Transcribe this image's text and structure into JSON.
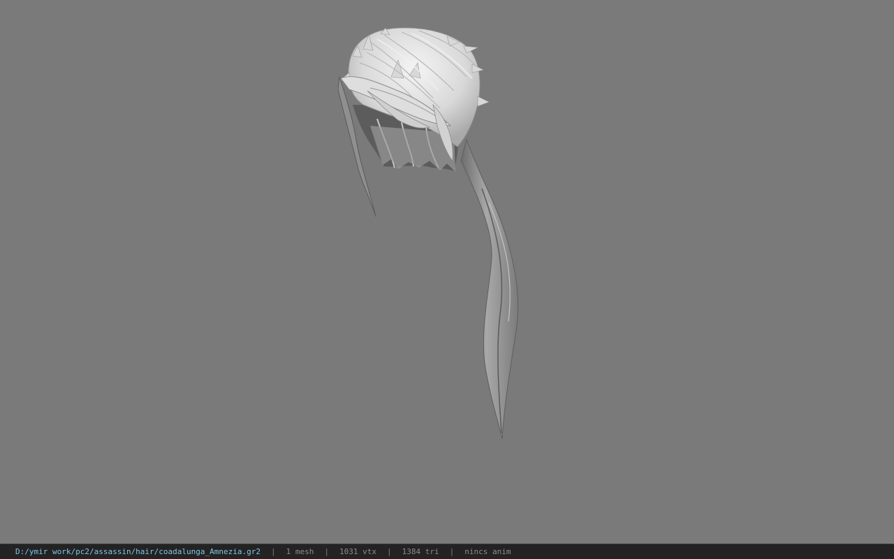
{
  "viewport": {
    "background": "#7a7a7a",
    "model_name": "hair-model-icon"
  },
  "statusbar": {
    "path": "D:/ymir work/pc2/assassin/hair/coadalunga_Amnezia.gr2",
    "mesh": "1 mesh",
    "vtx": "1031 vtx",
    "tri": "1384 tri",
    "anim": "nincs anim",
    "separator": "|",
    "path_color": "#7fc6e6"
  }
}
